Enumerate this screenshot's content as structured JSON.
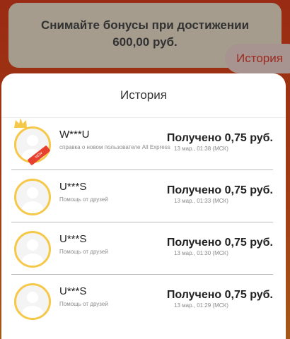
{
  "background": {
    "promo_text": "Снимайте бонусы при достижении 600,00 руб.",
    "history_button": "История"
  },
  "sheet": {
    "title": "История",
    "items": [
      {
        "name": "W***U",
        "description": "справка о новом пользователе All Express",
        "amount": "Получено 0,75 руб.",
        "time": "13 мар., 01:38 (МСК)",
        "badge": true
      },
      {
        "name": "U***S",
        "description": "Помощь от друзей",
        "amount": "Получено 0,75 руб.",
        "time": "13 мар., 01:33 (МСК)",
        "badge": false
      },
      {
        "name": "U***S",
        "description": "Помощь от друзей",
        "amount": "Получено 0,75 руб.",
        "time": "13 мар., 01:30 (МСК)",
        "badge": false
      },
      {
        "name": "U***S",
        "description": "Помощь от друзей",
        "amount": "Получено 0,75 руб.",
        "time": "13 мар., 01:29 (МСК)",
        "badge": false
      }
    ]
  },
  "colors": {
    "accent_red": "#e8402f",
    "avatar_ring": "#f6c84a"
  }
}
